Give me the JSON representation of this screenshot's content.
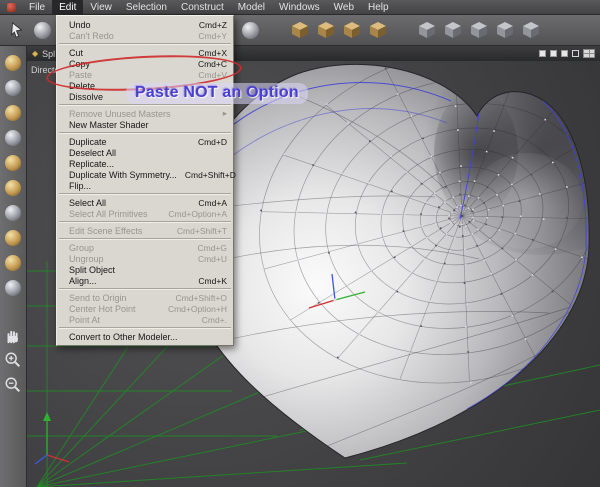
{
  "menubar": {
    "items": [
      "File",
      "Edit",
      "View",
      "Selection",
      "Construct",
      "Model",
      "Windows",
      "Web",
      "Help"
    ],
    "active": "Edit"
  },
  "edit_menu": {
    "items": [
      {
        "label": "Undo",
        "shortcut": "Cmd+Z"
      },
      {
        "label": "Can't Redo",
        "shortcut": "Cmd+Y",
        "disabled": true
      },
      {
        "sep": true
      },
      {
        "label": "Cut",
        "shortcut": "Cmd+X"
      },
      {
        "label": "Copy",
        "shortcut": "Cmd+C"
      },
      {
        "label": "Paste",
        "shortcut": "Cmd+V",
        "disabled": true
      },
      {
        "label": "Delete"
      },
      {
        "label": "Dissolve"
      },
      {
        "sep": true
      },
      {
        "label": "Remove Unused Masters",
        "submenu": true,
        "disabled": true
      },
      {
        "label": "New Master Shader"
      },
      {
        "sep": true
      },
      {
        "label": "Duplicate",
        "shortcut": "Cmd+D"
      },
      {
        "label": "Deselect All"
      },
      {
        "label": "Replicate..."
      },
      {
        "label": "Duplicate With Symmetry...",
        "shortcut": "Cmd+Shift+D"
      },
      {
        "label": "Flip..."
      },
      {
        "sep": true
      },
      {
        "label": "Select All",
        "shortcut": "Cmd+A"
      },
      {
        "label": "Select All Primitives",
        "shortcut": "Cmd+Option+A",
        "disabled": true
      },
      {
        "sep": true
      },
      {
        "label": "Edit Scene Effects",
        "shortcut": "Cmd+Shift+T",
        "disabled": true
      },
      {
        "sep": true
      },
      {
        "label": "Group",
        "shortcut": "Cmd+G",
        "disabled": true
      },
      {
        "label": "Ungroup",
        "shortcut": "Cmd+U",
        "disabled": true
      },
      {
        "label": "Split Object"
      },
      {
        "label": "Align...",
        "shortcut": "Cmd+K"
      },
      {
        "sep": true
      },
      {
        "label": "Send to Origin",
        "shortcut": "Cmd+Shift+O",
        "disabled": true
      },
      {
        "label": "Center Hot Point",
        "shortcut": "Cmd+Option+H",
        "disabled": true
      },
      {
        "label": "Point At",
        "shortcut": "Cmd+.",
        "disabled": true
      },
      {
        "sep": true
      },
      {
        "label": "Convert to Other Modeler..."
      }
    ]
  },
  "toolbar": {
    "groups": [
      {
        "gap": true,
        "icons": [
          {
            "name": "pointer-tool-icon",
            "kind": "arrow"
          },
          {
            "name": "wire-sphere-tool-icon",
            "kind": "sphere"
          },
          {
            "name": "shaded-sphere-tool-icon",
            "kind": "sphere"
          },
          {
            "name": "gold-sphere-tool-icon",
            "kind": "sphere-gold"
          },
          {
            "name": "eye-tool-icon",
            "kind": "eye"
          },
          {
            "name": "magnet-tool-icon",
            "kind": "magnet"
          },
          {
            "name": "sphere-grid-tool-icon",
            "kind": "sphere"
          },
          {
            "name": "gold-sphere-tool-icon-2",
            "kind": "sphere-gold"
          },
          {
            "name": "ruler-tool-icon",
            "kind": "ruler"
          },
          {
            "name": "half-sphere-tool-icon",
            "kind": "sphere"
          }
        ]
      },
      {
        "gap": true,
        "icons": [
          {
            "name": "gold-cube-tool-icon-1",
            "kind": "cube-gold"
          },
          {
            "name": "gold-cube-tool-icon-2",
            "kind": "cube-gold"
          },
          {
            "name": "gold-cube-tool-icon-3",
            "kind": "cube-gold"
          },
          {
            "name": "gold-cube-tool-icon-4",
            "kind": "cube-gold"
          }
        ]
      },
      {
        "gap": false,
        "icons": [
          {
            "name": "gray-cube-tool-icon-1",
            "kind": "cube-gray"
          },
          {
            "name": "gray-cube-tool-icon-2",
            "kind": "cube-gray"
          },
          {
            "name": "gray-cube-tool-icon-3",
            "kind": "cube-gray"
          },
          {
            "name": "gray-cube-tool-icon-4",
            "kind": "cube-gray"
          },
          {
            "name": "gray-cube-tool-icon-5",
            "kind": "cube-gray"
          }
        ]
      }
    ]
  },
  "sidebar": {
    "tools": [
      {
        "name": "vertex-tool-icon-1",
        "kind": "ball-gold"
      },
      {
        "name": "vertex-tool-icon-2",
        "kind": "ball-gray"
      },
      {
        "name": "vertex-tool-icon-3",
        "kind": "ball-gold"
      },
      {
        "name": "vertex-tool-icon-4",
        "kind": "ball-gray"
      },
      {
        "name": "vertex-tool-icon-5",
        "kind": "ball-gold"
      },
      {
        "name": "vertex-tool-icon-6",
        "kind": "ball-gold"
      },
      {
        "name": "vertex-tool-icon-7",
        "kind": "ball-gray"
      },
      {
        "name": "vertex-tool-icon-8",
        "kind": "ball-gold"
      },
      {
        "name": "vertex-tool-icon-9",
        "kind": "ball-gold"
      },
      {
        "name": "vertex-tool-icon-10",
        "kind": "ball-gray"
      }
    ],
    "nav": [
      {
        "name": "pan-hand-icon",
        "kind": "hand"
      },
      {
        "name": "zoom-in-icon",
        "kind": "zoom-in"
      },
      {
        "name": "zoom-out-icon",
        "kind": "zoom-out"
      }
    ]
  },
  "viewport": {
    "window_title": "Spl",
    "title_icon_glyph": "◆",
    "camera_label": "Director",
    "display_modes": [
      "filled",
      "filled",
      "filled",
      "outline",
      "quad"
    ]
  },
  "annotation": {
    "text": "Paste NOT an Option",
    "text_color": "#4b3fd0",
    "ellipse_color": "#ce2a2a"
  },
  "colors": {
    "grid_green": "#1c9122",
    "edge_blue": "#4343d6",
    "wire": "rgba(38,38,46,0.38)",
    "vertex_light": "#dcdce6",
    "vertex_dark": "#52525a",
    "axis_red": "#d03030",
    "axis_green": "#2fb32f",
    "axis_blue": "#3a5adf"
  }
}
